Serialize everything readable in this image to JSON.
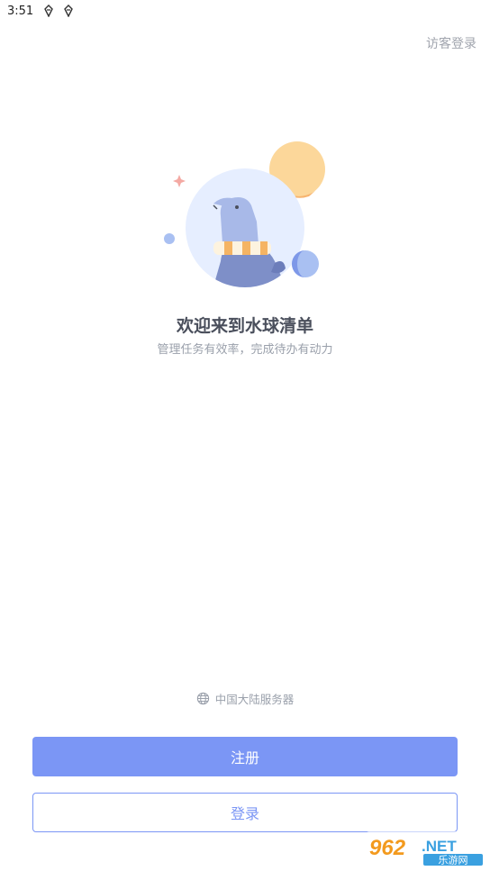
{
  "status_bar": {
    "time": "3:51"
  },
  "header": {
    "guest_login_label": "访客登录"
  },
  "welcome": {
    "title": "欢迎来到水球清单",
    "subtitle": "管理任务有效率，完成待办有动力"
  },
  "server": {
    "label": "中国大陆服务器",
    "icon": "globe-icon"
  },
  "actions": {
    "register_label": "注册",
    "login_label": "登录"
  },
  "watermark": {
    "brand": "962",
    "suffix": ".NET",
    "caption": "乐游网"
  },
  "colors": {
    "accent": "#7b96f5",
    "title": "#4a4f5c",
    "muted": "#9aa0ab"
  }
}
